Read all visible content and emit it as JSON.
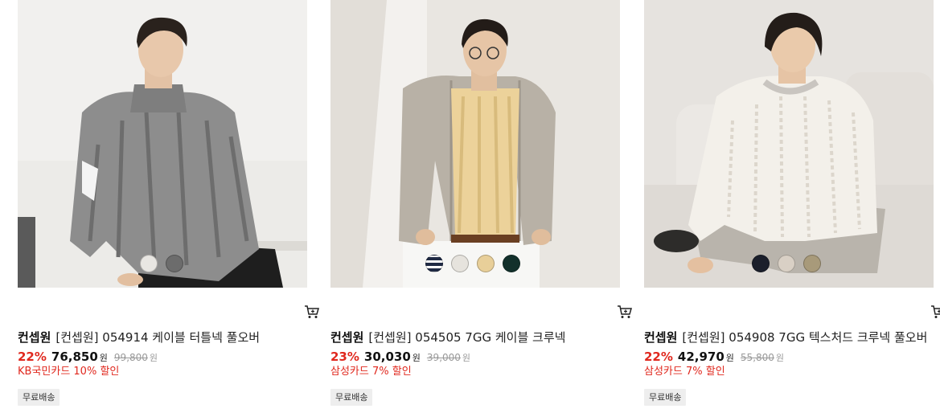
{
  "products": [
    {
      "brand": "컨셉원",
      "name": "[컨셉원] 054914 케이블 터틀넥 풀오버",
      "discount": "22%",
      "price": "76,850",
      "original_price": "99,800",
      "currency": "원",
      "card_promo": "KB국민카드 10% 할인",
      "shipping": "무료배송",
      "swatch_colors": [
        "#e8e6e2",
        "#6c6c6c"
      ],
      "cart_icon": "cart-icon"
    },
    {
      "brand": "컨셉원",
      "name": "[컨셉원] 054505 7GG 케이블 크루넥",
      "discount": "23%",
      "price": "30,030",
      "original_price": "39,000",
      "currency": "원",
      "card_promo": "삼성카드 7% 할인",
      "shipping": "무료배송",
      "swatch_colors": [
        "#1f2a44",
        "#e6e3dd",
        "#e8cf99",
        "#12302b"
      ],
      "cart_icon": "cart-icon"
    },
    {
      "brand": "컨셉원",
      "name": "[컨셉원] 054908 7GG 텍스처드 크루넥 풀오버",
      "discount": "22%",
      "price": "42,970",
      "original_price": "55,800",
      "currency": "원",
      "card_promo": "삼성카드 7% 할인",
      "shipping": "무료배송",
      "swatch_colors": [
        "#1b1f2b",
        "#d9d0c5",
        "#a89a7a"
      ],
      "cart_icon": "cart-icon"
    }
  ]
}
